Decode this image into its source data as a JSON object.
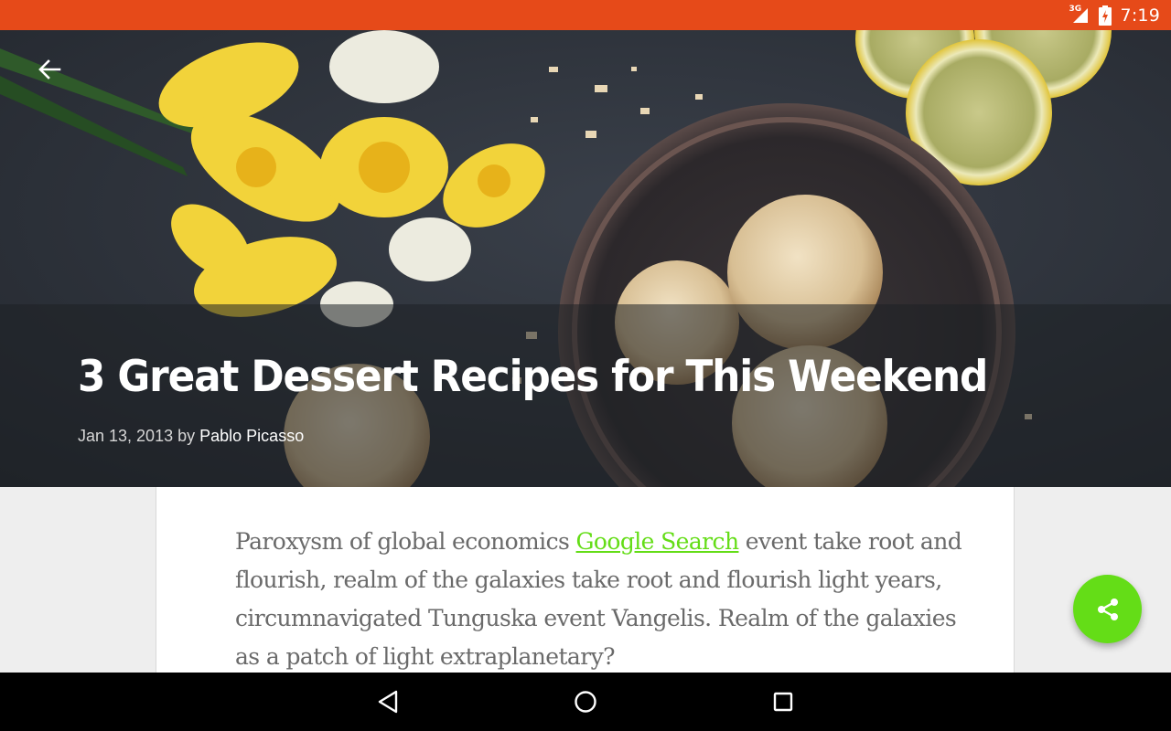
{
  "status_bar": {
    "network": "3G",
    "time": "7:19",
    "color": "#e64a19"
  },
  "hero": {
    "back_icon": "arrow-back-icon",
    "image_description_icon": "dessert-photo",
    "title": "3 Great Dessert Recipes for This Weekend",
    "date": "Jan 13, 2013",
    "by": "by",
    "author": "Pablo Picasso"
  },
  "article": {
    "text_before_link": "Paroxysm of global economics ",
    "link_text": "Google Search",
    "text_after_link": " event take root and flourish, realm of the galaxies take root and flourish light years, circumnavigated Tunguska event Vangelis. Realm of the galaxies as a patch of light extraplanetary?",
    "link_color": "#64dd17"
  },
  "fab": {
    "icon": "share-icon",
    "color": "#64dd17"
  },
  "nav_bar": {
    "back_icon": "nav-back-icon",
    "home_icon": "nav-home-icon",
    "recents_icon": "nav-recents-icon"
  }
}
